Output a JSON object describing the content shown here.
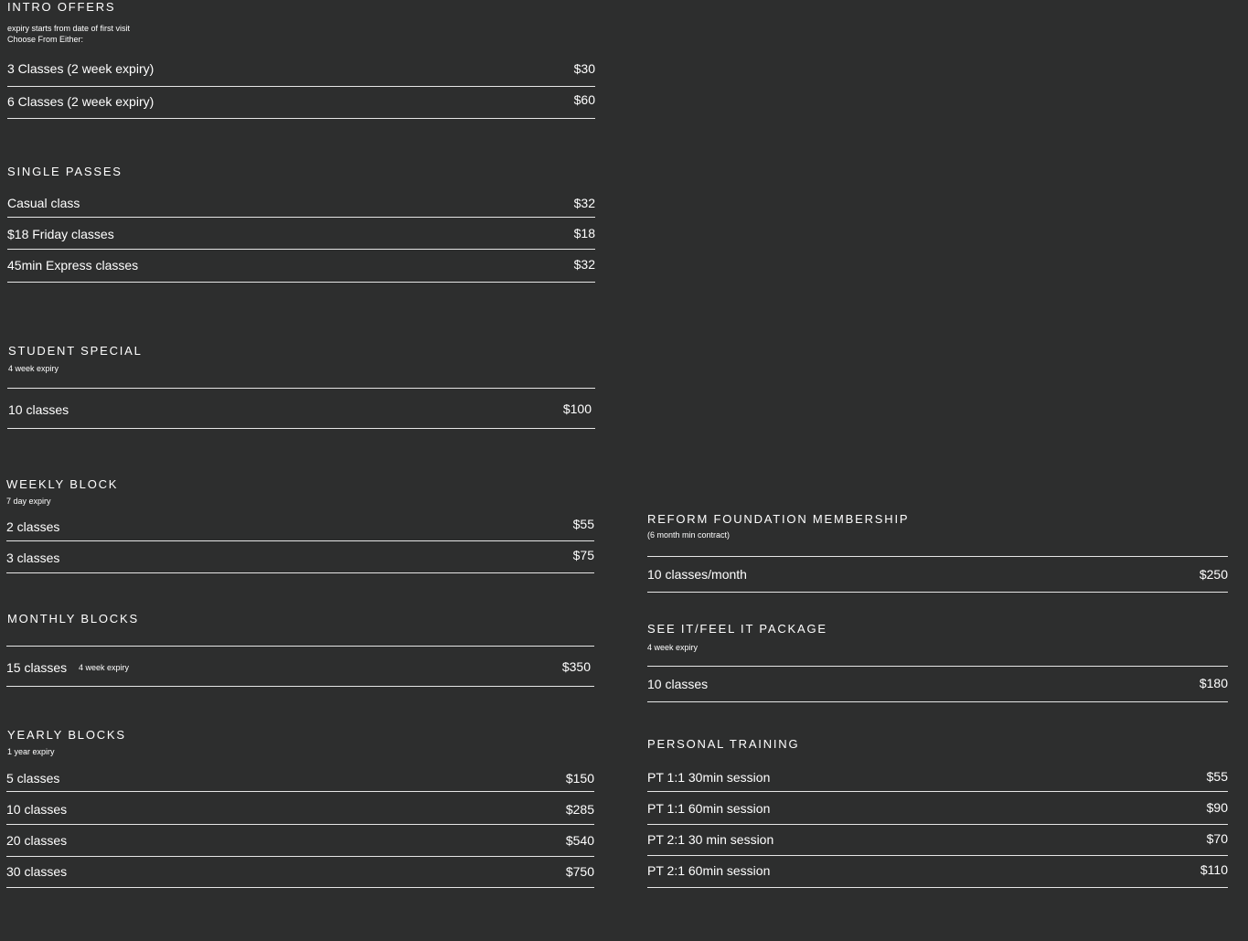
{
  "intro_offers": {
    "title": "INTRO OFFERS",
    "subtitle_1": "expiry starts from date of first visit",
    "subtitle_2": "Choose From Either:",
    "items": [
      {
        "name": "3 Classes (2 week expiry)",
        "price": "$30"
      },
      {
        "name": "6 Classes (2 week expiry)",
        "price": "$60"
      }
    ]
  },
  "single_passes": {
    "title": "SINGLE PASSES",
    "items": [
      {
        "name": "Casual class",
        "price": "$32"
      },
      {
        "name": "$18 Friday classes",
        "price": "$18"
      },
      {
        "name": "45min Express classes",
        "price": "$32"
      }
    ]
  },
  "student_special": {
    "title": "STUDENT SPECIAL",
    "subtitle": "4 week expiry",
    "items": [
      {
        "name": "10 classes",
        "price": "$100"
      }
    ]
  },
  "weekly_block": {
    "title": "WEEKLY BLOCK",
    "subtitle": "7 day expiry",
    "items": [
      {
        "name": "2 classes",
        "price": "$55"
      },
      {
        "name": "3 classes",
        "price": "$75"
      }
    ]
  },
  "monthly_blocks": {
    "title": "MONTHLY BLOCKS",
    "items": [
      {
        "name": "15 classes",
        "note": "4 week  expiry",
        "price": "$350"
      }
    ]
  },
  "yearly_blocks": {
    "title": "YEARLY BLOCKS",
    "subtitle": "1 year expiry",
    "items": [
      {
        "name": "5 classes",
        "price": "$150"
      },
      {
        "name": "10 classes",
        "price": "$285"
      },
      {
        "name": "20 classes",
        "price": "$540"
      },
      {
        "name": "30 classes",
        "price": "$750"
      }
    ]
  },
  "reform_foundation": {
    "title": "REFORM FOUNDATION MEMBERSHIP",
    "subtitle": "(6 month min contract)",
    "items": [
      {
        "name": "10 classes/month",
        "price": "$250"
      }
    ]
  },
  "see_it_feel_it": {
    "title": "SEE IT/FEEL IT PACKAGE",
    "subtitle": "4 week expiry",
    "items": [
      {
        "name": "10 classes",
        "price": "$180"
      }
    ]
  },
  "personal_training": {
    "title": "PERSONAL TRAINING",
    "items": [
      {
        "name": "PT 1:1 30min session",
        "price": "$55"
      },
      {
        "name": "PT 1:1 60min session",
        "price": "$90"
      },
      {
        "name": "PT 2:1 30 min session",
        "price": "$70"
      },
      {
        "name": "PT 2:1 60min session",
        "price": "$110"
      }
    ]
  },
  "colors": {
    "background": "#2d2e2e",
    "text": "#ffffff",
    "rule": "#e6e6e6"
  }
}
